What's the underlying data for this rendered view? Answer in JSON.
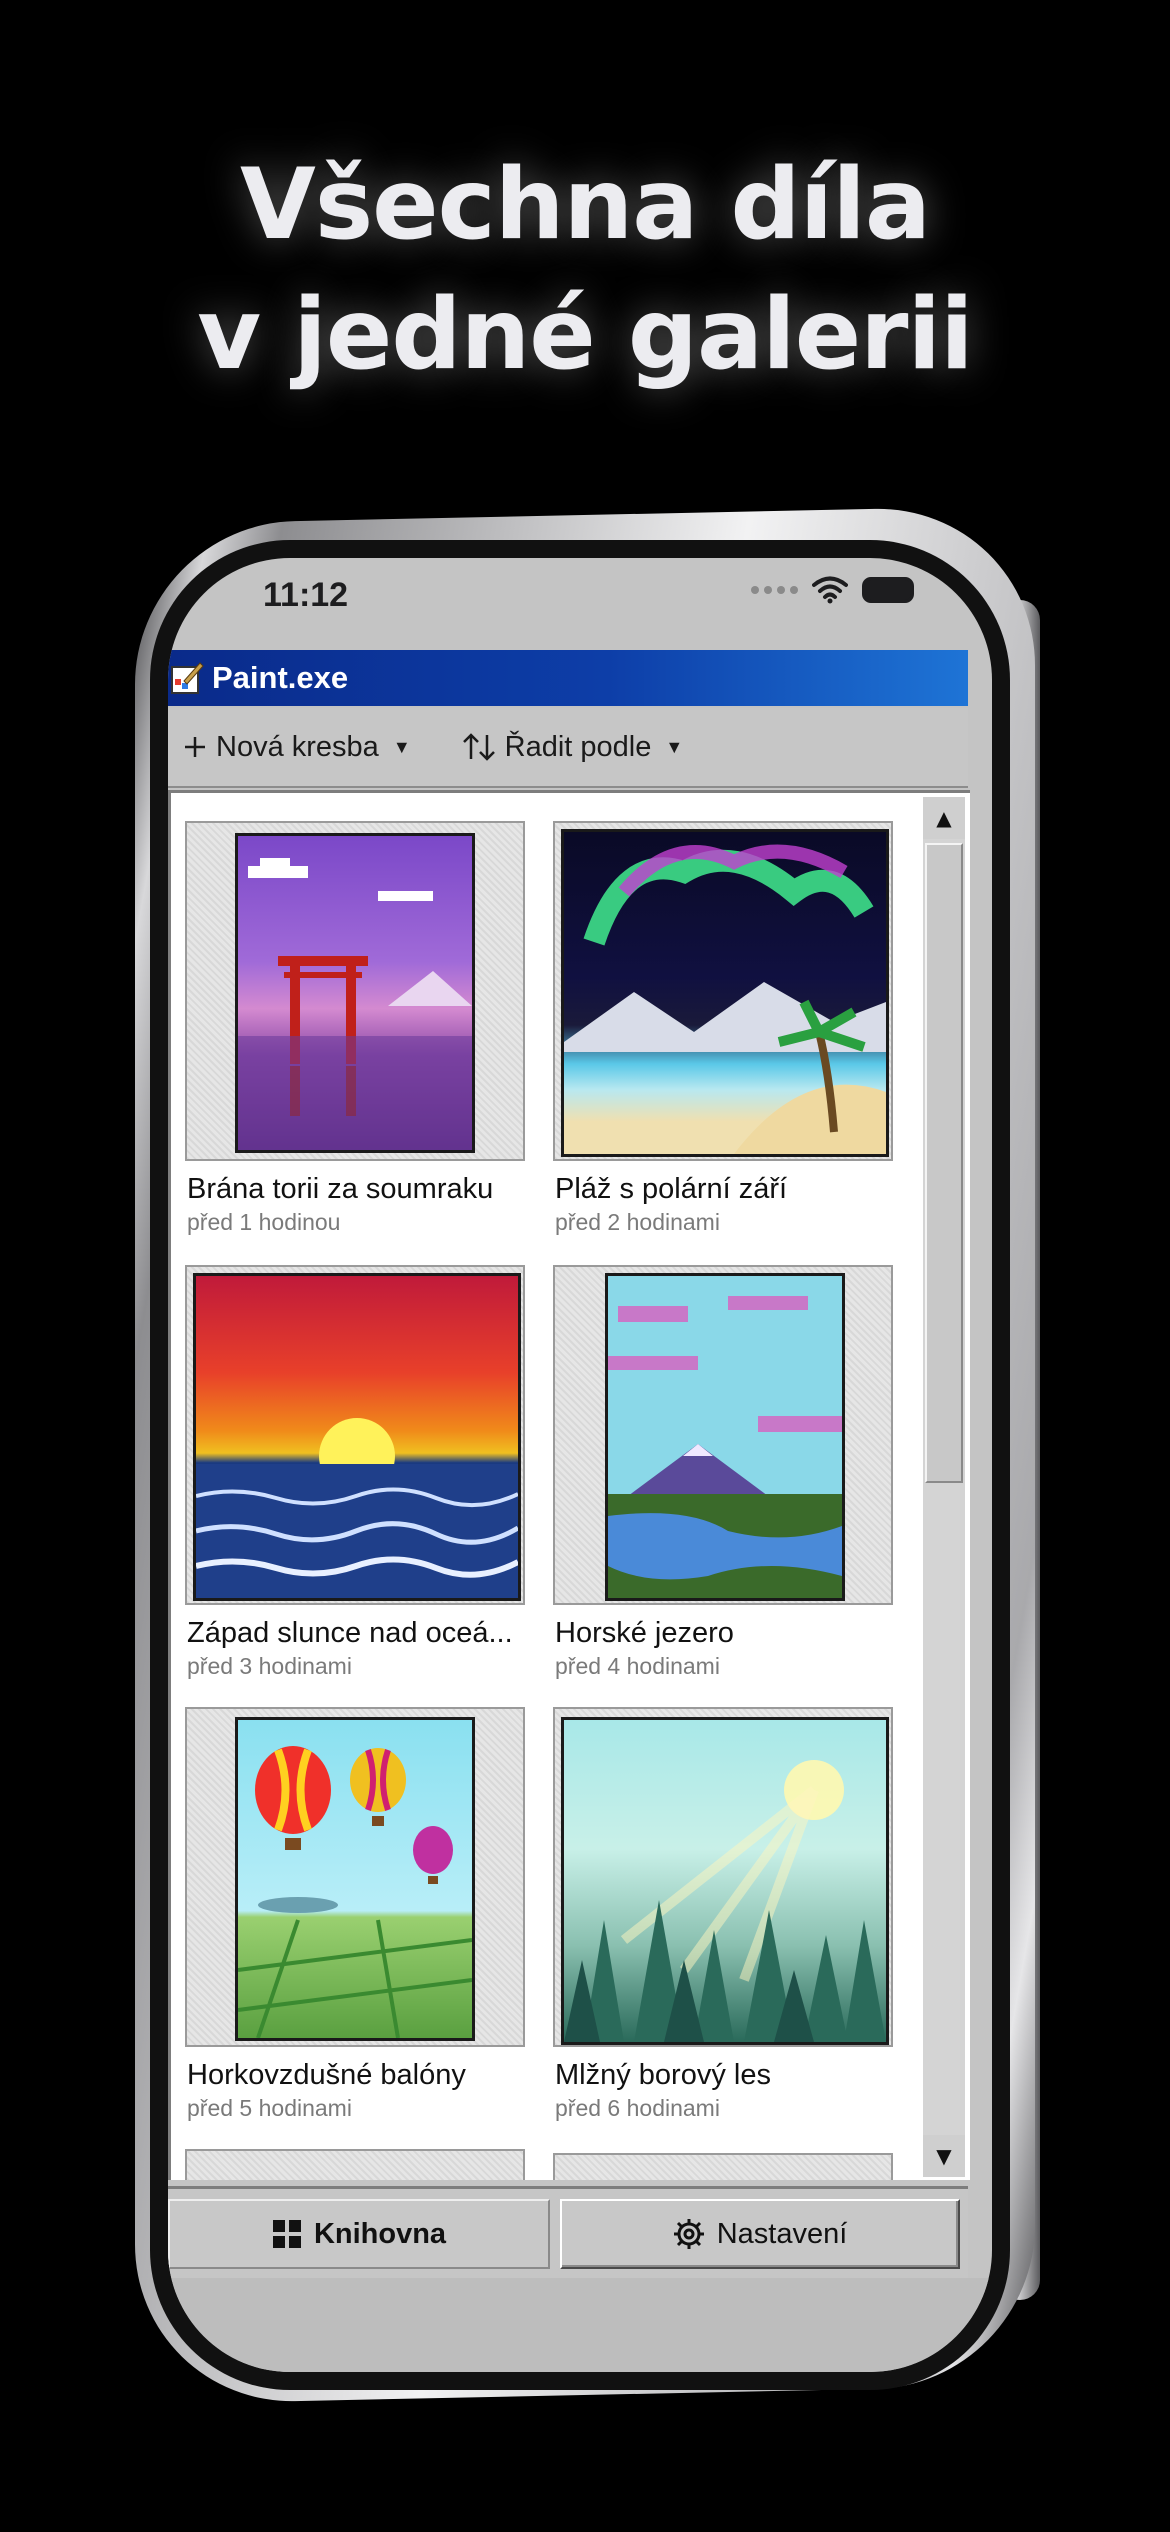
{
  "headline": {
    "line1": "Všechna díla",
    "line2": "v jedné galerii"
  },
  "status": {
    "time": "11:12"
  },
  "window": {
    "title": "Paint.exe"
  },
  "toolbar": {
    "new_label": "Nová kresba",
    "sort_label": "Řadit podle"
  },
  "gallery": {
    "items": [
      {
        "title": "Brána torii za soumraku",
        "subtitle": "před 1 hodinou"
      },
      {
        "title": "Pláž s polární září",
        "subtitle": "před 2 hodinami"
      },
      {
        "title": "Západ slunce nad oceá...",
        "subtitle": "před 3 hodinami"
      },
      {
        "title": "Horské jezero",
        "subtitle": "před 4 hodinami"
      },
      {
        "title": "Horkovzdušné balóny",
        "subtitle": "před 5 hodinami"
      },
      {
        "title": "Mlžný borový les",
        "subtitle": "před 6 hodinami"
      }
    ]
  },
  "tabs": {
    "library": "Knihovna",
    "settings": "Nastavení"
  },
  "colors": {
    "titlebar_start": "#0a2a8a",
    "titlebar_end": "#1e74d6",
    "chrome": "#c6c6c6"
  },
  "icons": [
    "paint-app-icon",
    "plus-icon",
    "sort-arrows-icon",
    "chevron-down-icon",
    "wifi-icon",
    "battery-icon",
    "scroll-up-icon",
    "scroll-down-icon",
    "grid-icon",
    "gear-icon"
  ]
}
